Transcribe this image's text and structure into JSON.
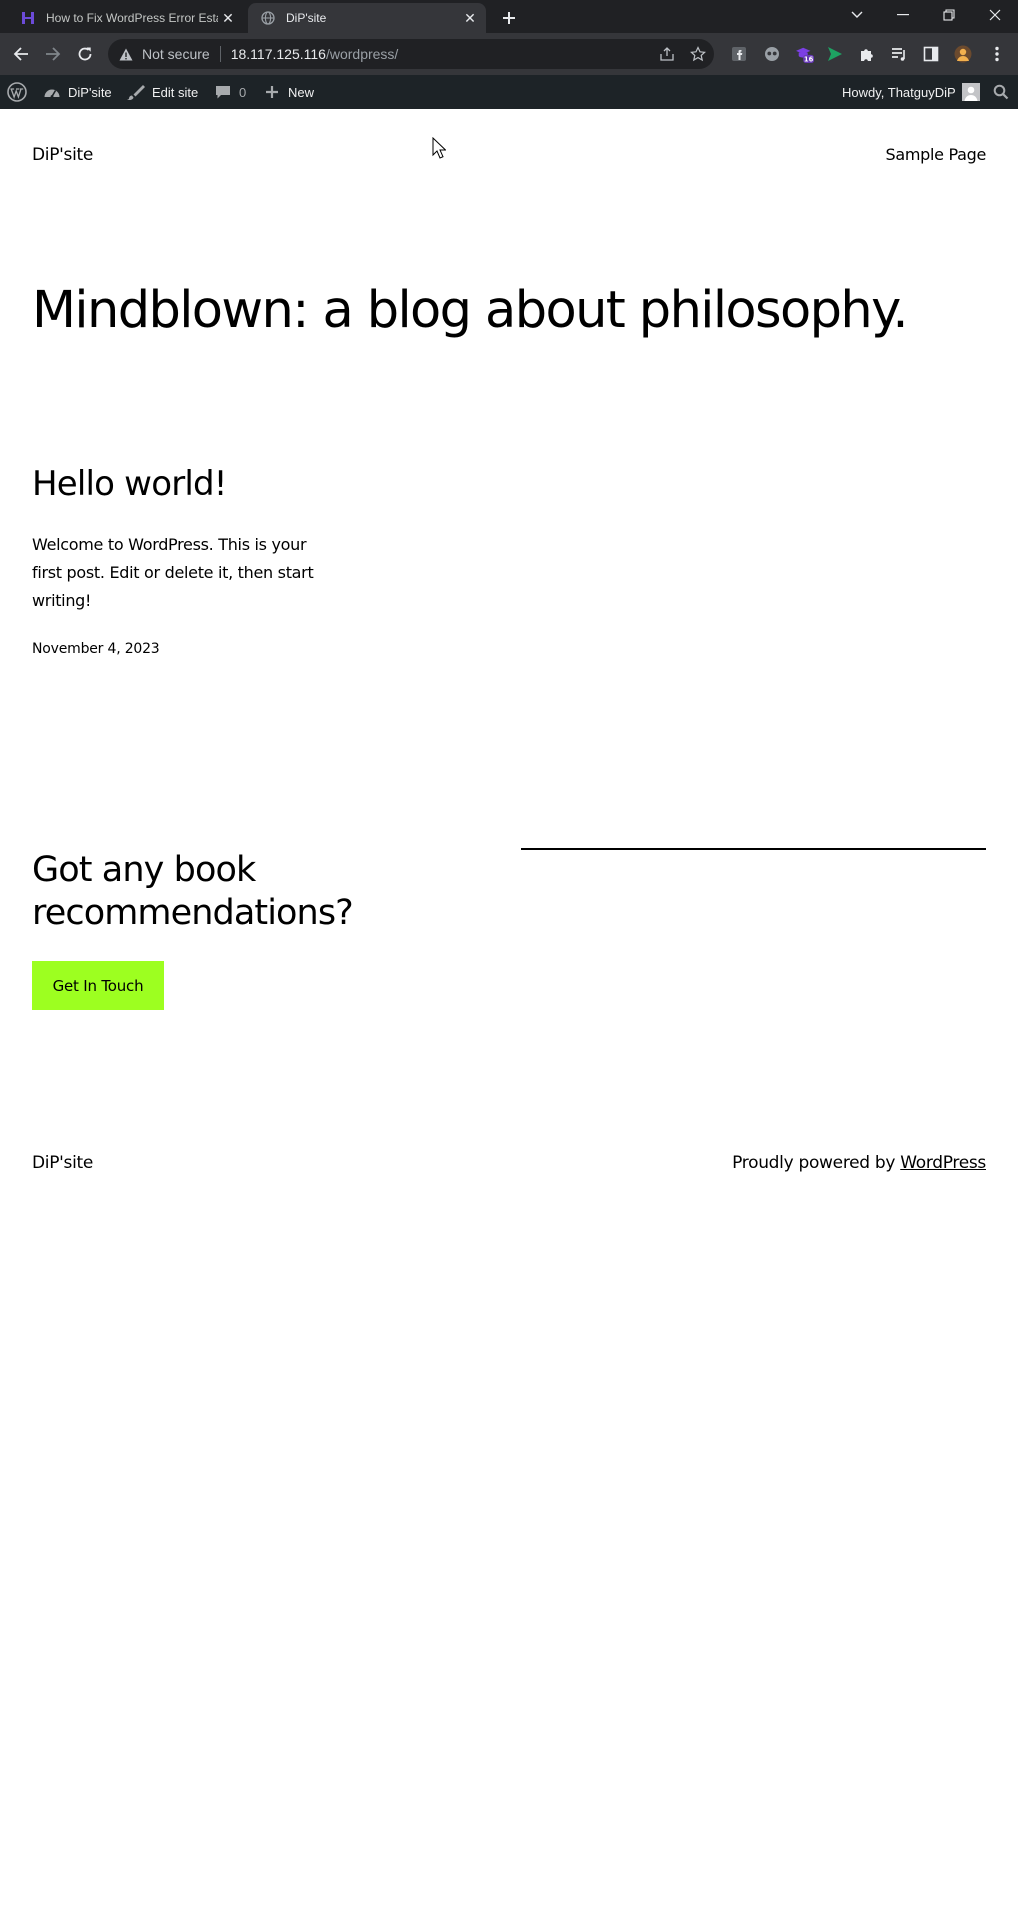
{
  "browser": {
    "tabs": [
      {
        "title": "How to Fix WordPress Error Esta",
        "active": false,
        "favicon": "h-logo-icon"
      },
      {
        "title": "DiP'site",
        "active": true,
        "favicon": "globe-icon"
      }
    ],
    "new_tab_icon": "plus-icon",
    "address": {
      "security_label": "Not secure",
      "host": "18.117.125.116",
      "path": "/wordpress/"
    },
    "extension_badge": "16"
  },
  "admin_bar": {
    "site_name": "DiP'site",
    "edit_site": "Edit site",
    "comments_count": "0",
    "new_label": "New",
    "greeting": "Howdy, ThatguyDiP"
  },
  "site": {
    "title": "DiP'site",
    "nav": [
      "Sample Page"
    ],
    "tagline": "Mindblown: a blog about philosophy."
  },
  "post": {
    "title": "Hello world!",
    "excerpt": "Welcome to WordPress. This is your first post. Edit or delete it, then start writing!",
    "date": "November 4, 2023"
  },
  "cta": {
    "heading": "Got any book recommendations?",
    "button": "Get In Touch",
    "button_color": "#9dff20"
  },
  "footer": {
    "title": "DiP'site",
    "credit_prefix": "Proudly powered by ",
    "credit_link": "WordPress"
  },
  "colors": {
    "chrome_dark": "#202124",
    "chrome_toolbar": "#35363a",
    "admin_bar": "#1d2327"
  }
}
